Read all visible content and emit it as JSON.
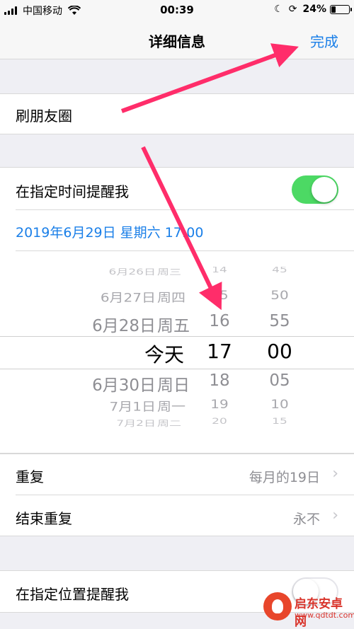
{
  "status_bar": {
    "carrier": "中国移动",
    "time": "00:39",
    "battery": "24%",
    "battery_level": 0.24
  },
  "nav": {
    "title": "详细信息",
    "done_label": "完成"
  },
  "list_name": "刷朋友圈",
  "remind_time": {
    "label": "在指定时间提醒我",
    "enabled": true,
    "datetime": "2019年6月29日 星期六 17:00"
  },
  "picker": {
    "rows": [
      {
        "date": "6月26日",
        "day": "周三",
        "hour": "14",
        "minute": "45"
      },
      {
        "date": "6月27日",
        "day": "周四",
        "hour": "15",
        "minute": "50"
      },
      {
        "date": "6月28日",
        "day": "周五",
        "hour": "16",
        "minute": "55"
      },
      {
        "date": "今天",
        "day": "",
        "hour": "17",
        "minute": "00"
      },
      {
        "date": "6月30日",
        "day": "周日",
        "hour": "18",
        "minute": "05"
      },
      {
        "date": "7月1日",
        "day": "周一",
        "hour": "19",
        "minute": "10"
      },
      {
        "date": "7月2日",
        "day": "周二",
        "hour": "20",
        "minute": "15"
      }
    ]
  },
  "repeat": {
    "label": "重复",
    "value": "每月的19日"
  },
  "end_repeat": {
    "label": "结束重复",
    "value": "永不"
  },
  "remind_location": {
    "label": "在指定位置提醒我",
    "enabled": false
  },
  "watermark": {
    "name": "启东安卓网",
    "url": "www.qdtdt.com"
  },
  "colors": {
    "accent": "#1a7fe8",
    "toggle_on": "#4cd964",
    "arrow": "#ff2d6a"
  }
}
